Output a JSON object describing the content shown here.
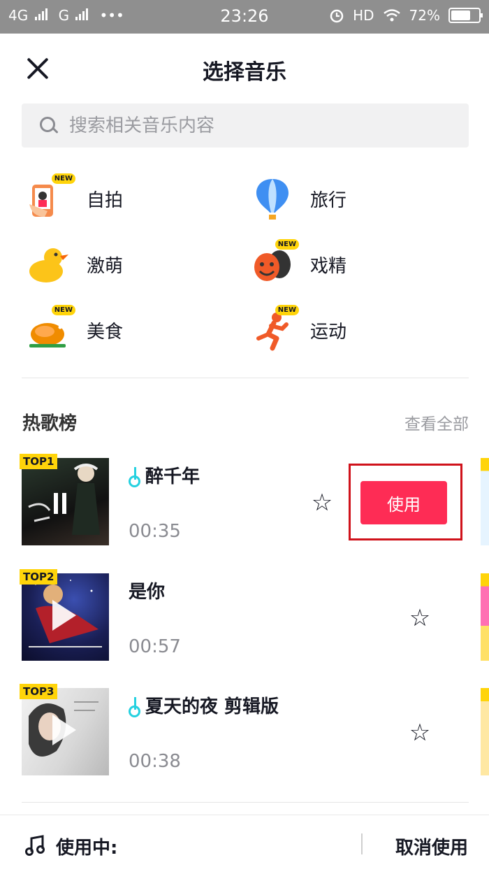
{
  "status_bar": {
    "network1": "4G",
    "network2": "G",
    "dots": "•••",
    "time": "23:26",
    "hd": "HD",
    "battery": "72%",
    "battery_level": 0.72
  },
  "header": {
    "title": "选择音乐",
    "close_icon": "close-icon"
  },
  "search": {
    "placeholder": "搜索相关音乐内容"
  },
  "categories": [
    {
      "label": "自拍",
      "icon": "selfie-icon",
      "new": true,
      "new_label": "NEW"
    },
    {
      "label": "旅行",
      "icon": "balloon-icon",
      "new": false
    },
    {
      "label": "激萌",
      "icon": "duck-icon",
      "new": false
    },
    {
      "label": "戏精",
      "icon": "drama-mask-icon",
      "new": true,
      "new_label": "NEW"
    },
    {
      "label": "美食",
      "icon": "roast-chicken-icon",
      "new": true,
      "new_label": "NEW"
    },
    {
      "label": "运动",
      "icon": "runner-icon",
      "new": true,
      "new_label": "NEW"
    }
  ],
  "hot_list": {
    "title": "热歌榜",
    "see_all": "查看全部",
    "songs": [
      {
        "rank": "TOP1",
        "name": "醉千年",
        "artist": "",
        "duration": "00:35",
        "selected": true
      },
      {
        "rank": "TOP2",
        "name": "是你",
        "artist": "",
        "duration": "00:57",
        "selected": false
      },
      {
        "rank": "TOP3",
        "name": "夏天的夜 剪辑版",
        "artist": "",
        "duration": "00:38",
        "selected": false
      }
    ],
    "use_label": "使用"
  },
  "bottom_bar": {
    "using_label": "使用中:",
    "current_song": "",
    "cancel_label": "取消使用"
  },
  "colors": {
    "accent": "#fe2c55",
    "badge": "#ffd40a",
    "highlight_box": "#d0121b",
    "note": "#25d1e0"
  }
}
